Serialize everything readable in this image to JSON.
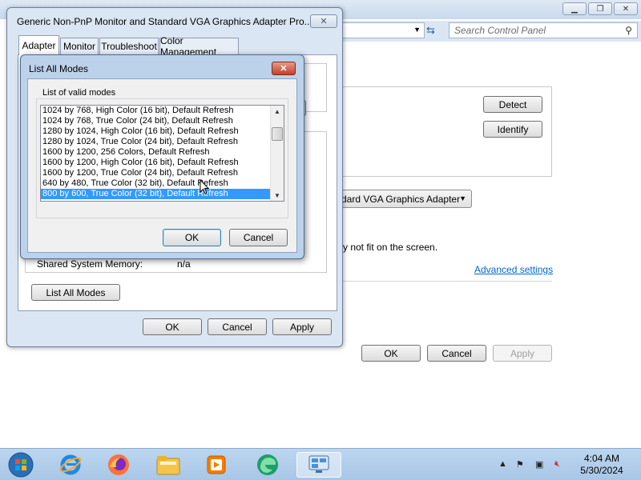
{
  "background": {
    "search_placeholder": "Search Control Panel",
    "detect_label": "Detect",
    "identify_label": "Identify",
    "display_dropdown": "dard VGA Graphics Adapter",
    "fit_text": "y not fit on the screen.",
    "advanced_settings_label": "Advanced settings",
    "ok_label": "OK",
    "cancel_label": "Cancel",
    "apply_label": "Apply"
  },
  "properties_dialog": {
    "title": "Generic Non-PnP Monitor and Standard VGA Graphics Adapter Pro...",
    "tabs": [
      {
        "label": "Adapter"
      },
      {
        "label": "Monitor"
      },
      {
        "label": "Troubleshoot"
      },
      {
        "label": "Color Management"
      }
    ],
    "shared_memory_label": "Shared System Memory:",
    "shared_memory_value": "n/a",
    "list_all_modes_label": "List All Modes",
    "ok_label": "OK",
    "cancel_label": "Cancel",
    "apply_label": "Apply"
  },
  "modes_dialog": {
    "title": "List All Modes",
    "list_label": "List of valid modes",
    "modes": [
      "1024 by 768, High Color (16 bit), Default Refresh",
      "1024 by 768, True Color (24 bit), Default Refresh",
      "1280 by 1024, High Color (16 bit), Default Refresh",
      "1280 by 1024, True Color (24 bit), Default Refresh",
      "1600 by 1200, 256 Colors, Default Refresh",
      "1600 by 1200, High Color (16 bit), Default Refresh",
      "1600 by 1200, True Color (24 bit), Default Refresh",
      "640 by 480, True Color (32 bit), Default Refresh",
      "800 by 600, True Color (32 bit), Default Refresh"
    ],
    "selected_index": 8,
    "ok_label": "OK",
    "cancel_label": "Cancel"
  },
  "taskbar": {
    "time": "4:04 AM",
    "date": "5/30/2024"
  },
  "colors": {
    "selection": "#3399ff",
    "link": "#0066cc",
    "close_button": "#c2412c"
  }
}
